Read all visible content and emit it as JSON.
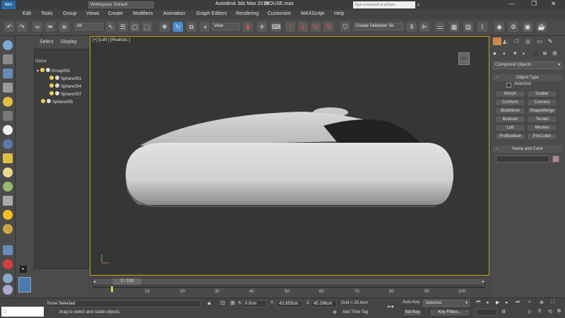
{
  "title": {
    "workspace": "Workspace: Default",
    "app": "Autodesk 3ds Max  2015",
    "file": "MOUSE.max",
    "search_placeholder": "Type a keyword or phrase"
  },
  "menu": [
    "Edit",
    "Tools",
    "Group",
    "Views",
    "Create",
    "Modifiers",
    "Animation",
    "Graph Editors",
    "Rendering",
    "Customize",
    "MAXScript",
    "Help"
  ],
  "toolbar": {
    "selection_filter": "All",
    "ref_coord": "View",
    "selection_set": "Create Selection Se"
  },
  "scene": {
    "tabs": [
      "Select",
      "Display"
    ],
    "column_header": "Name",
    "items": [
      "Group001",
      "Sphere001",
      "Sphere004",
      "Sphere007",
      "Sphere005"
    ]
  },
  "viewport": {
    "label": "[+] [Left ] [Realistic ]",
    "viewcube": "LEFT"
  },
  "command_panel": {
    "category": "Compound Objects",
    "object_type_title": "Object Type",
    "autogrid": "AutoGrid",
    "buttons": [
      "Morph",
      "Scatter",
      "Conform",
      "Connect",
      "BlobMesh",
      "ShapeMerge",
      "Boolean",
      "Terrain",
      "Loft",
      "Mesher",
      "ProBoolean",
      "ProCutter"
    ],
    "name_color_title": "Name and Color"
  },
  "timeline": {
    "frame_slider": "0 / 100",
    "ticks": [
      "0",
      "10",
      "20",
      "30",
      "40",
      "50",
      "60",
      "70",
      "80",
      "90",
      "100"
    ]
  },
  "status": {
    "selection": "None Selected",
    "prompt": "drag to select and rotate objects",
    "x_label": "X:",
    "x_value": "0.0cm",
    "y_label": "Y:",
    "y_value": "-62.653cm",
    "z_label": "Z:",
    "z_value": "45.196cm",
    "grid": "Grid = 25.4cm",
    "add_time_tag": "Add Time Tag",
    "auto_key": "Auto Key",
    "auto_key_mode": "Selected",
    "set_key": "Set Key",
    "key_filters": "Key Filters..."
  },
  "colors": {
    "viewport_border": "#c9a41a",
    "active_blue": "#4a8cd0"
  }
}
